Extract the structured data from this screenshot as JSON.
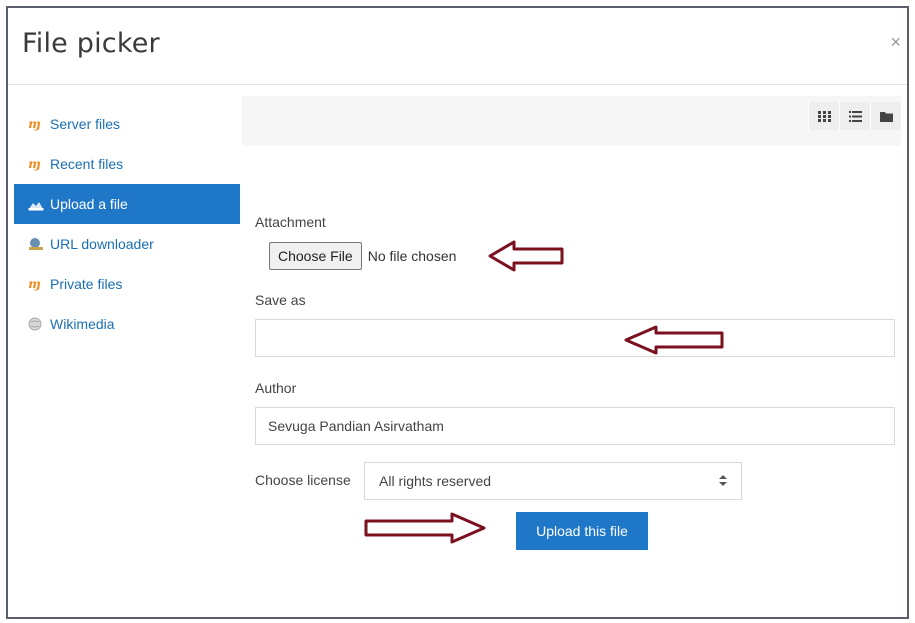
{
  "dialog": {
    "title": "File picker",
    "close_glyph": "×"
  },
  "sidebar": {
    "items": [
      {
        "label": "Server files",
        "icon": "moodle-icon"
      },
      {
        "label": "Recent files",
        "icon": "moodle-icon"
      },
      {
        "label": "Upload a file",
        "icon": "upload-icon",
        "active": true
      },
      {
        "label": "URL downloader",
        "icon": "url-downloader-icon"
      },
      {
        "label": "Private files",
        "icon": "moodle-icon"
      },
      {
        "label": "Wikimedia",
        "icon": "wikimedia-icon"
      }
    ]
  },
  "toolbar": {
    "view_icons": [
      "grid-view-icon",
      "list-view-icon",
      "folder-view-icon"
    ]
  },
  "form": {
    "attachment_label": "Attachment",
    "choose_file_label": "Choose File",
    "no_file_text": "No file chosen",
    "save_as_label": "Save as",
    "save_as_value": "",
    "author_label": "Author",
    "author_value": "Sevuga Pandian Asirvatham",
    "license_label": "Choose license",
    "license_value": "All rights reserved",
    "upload_button": "Upload this file"
  },
  "colors": {
    "accent": "#1f77c8",
    "arrow": "#7a1020",
    "link": "#1a6fb5"
  }
}
